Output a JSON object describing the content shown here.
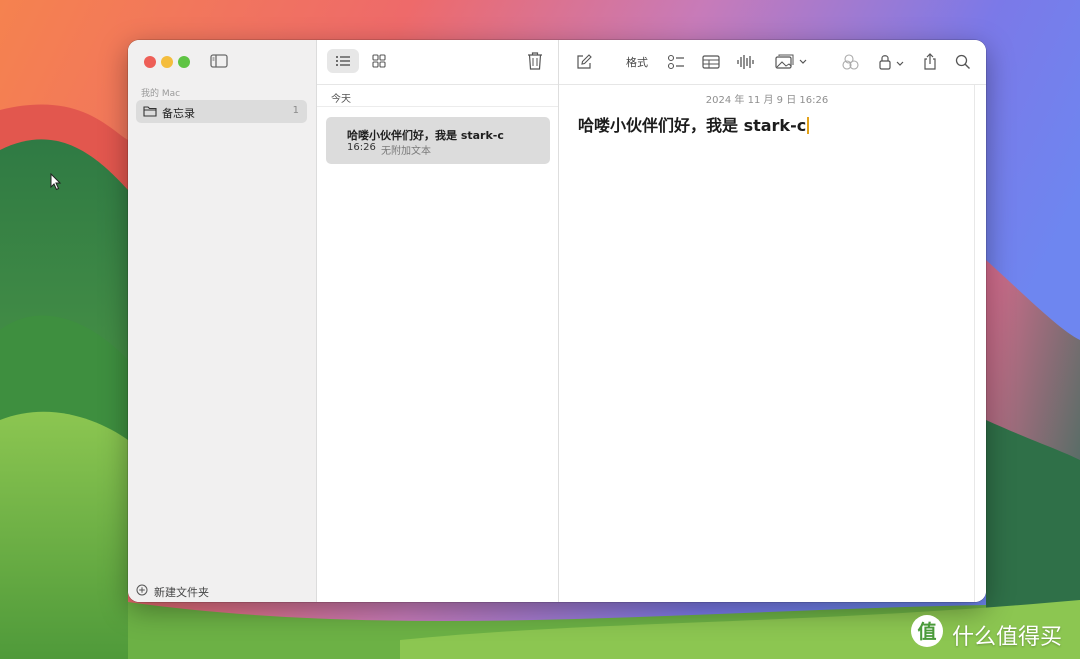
{
  "sidebar": {
    "section_label": "我的 Mac",
    "folders": [
      {
        "name": "备忘录",
        "count": "1"
      }
    ],
    "new_folder_label": "新建文件夹"
  },
  "notelist": {
    "group_header": "今天",
    "notes": [
      {
        "title": "哈喽小伙伴们好，我是 stark-c",
        "time": "16:26",
        "preview": "无附加文本"
      }
    ]
  },
  "editor": {
    "toolbar": {
      "format_label": "格式"
    },
    "date": "2024 年 11 月 9 日 16:26",
    "title": "哈喽小伙伴们好，我是 stark-c"
  },
  "watermark": {
    "text": "什么值得买"
  },
  "colors": {
    "close": "#ee5f57",
    "minimize": "#f4bd3d",
    "maximize": "#5fc444",
    "selection": "#dcdcdc",
    "caret": "#e3a21a"
  }
}
